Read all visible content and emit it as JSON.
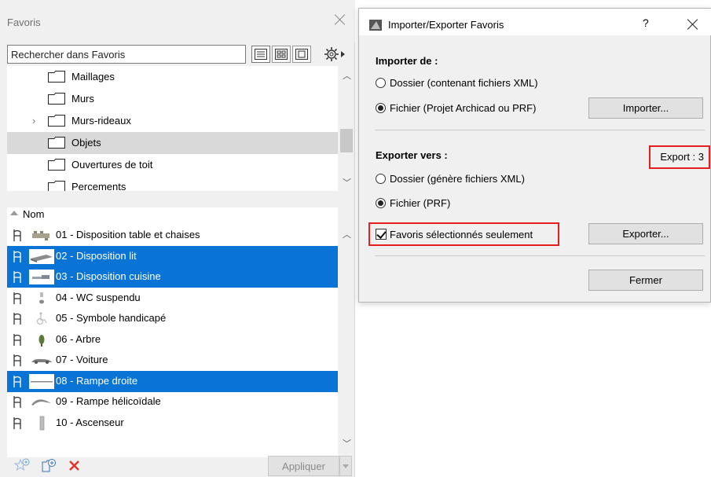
{
  "favorites": {
    "title": "Favoris",
    "search_placeholder": "Rechercher dans Favoris",
    "tree": [
      {
        "label": "Maillages",
        "expandable": false,
        "selected": false
      },
      {
        "label": "Murs",
        "expandable": false,
        "selected": false
      },
      {
        "label": "Murs-rideaux",
        "expandable": true,
        "selected": false
      },
      {
        "label": "Objets",
        "expandable": false,
        "selected": true
      },
      {
        "label": "Ouvertures de toit",
        "expandable": false,
        "selected": false
      },
      {
        "label": "Percements",
        "expandable": false,
        "selected": false
      }
    ],
    "list_header": "Nom",
    "items": [
      {
        "label": "01 - Disposition table et chaises",
        "selected": false,
        "icon": "table-chairs-thumbnail"
      },
      {
        "label": "02 - Disposition lit",
        "selected": true,
        "icon": "bed-thumbnail"
      },
      {
        "label": "03 - Disposition cuisine",
        "selected": true,
        "icon": "kitchen-thumbnail"
      },
      {
        "label": "04 - WC suspendu",
        "selected": false,
        "icon": "wc-thumbnail"
      },
      {
        "label": "05 - Symbole handicapé",
        "selected": false,
        "icon": "wheelchair-thumbnail"
      },
      {
        "label": "06 - Arbre",
        "selected": false,
        "icon": "tree-thumbnail"
      },
      {
        "label": "07 - Voiture",
        "selected": false,
        "icon": "car-thumbnail"
      },
      {
        "label": "08 - Rampe droite",
        "selected": true,
        "icon": "ramp-straight-thumbnail"
      },
      {
        "label": "09 - Rampe hélicoïdale",
        "selected": false,
        "icon": "ramp-helical-thumbnail"
      },
      {
        "label": "10 - Ascenseur",
        "selected": false,
        "icon": "elevator-thumbnail"
      }
    ],
    "apply_label": "Appliquer"
  },
  "dialog": {
    "title": "Importer/Exporter Favoris",
    "help": "?",
    "import_section": "Importer de :",
    "import_opt_folder": "Dossier (contenant fichiers XML)",
    "import_opt_file": "Fichier (Projet Archicad ou PRF)",
    "import_button": "Importer...",
    "export_section": "Exporter vers :",
    "export_count": "Export : 3",
    "export_opt_folder": "Dossier (génère fichiers XML)",
    "export_opt_file": "Fichier (PRF)",
    "selected_only": "Favoris sélectionnés seulement",
    "export_button": "Exporter...",
    "close_button": "Fermer"
  },
  "colors": {
    "selection": "#0a74d6",
    "highlight_box": "#e61e1e",
    "delete_icon": "#e53226"
  }
}
